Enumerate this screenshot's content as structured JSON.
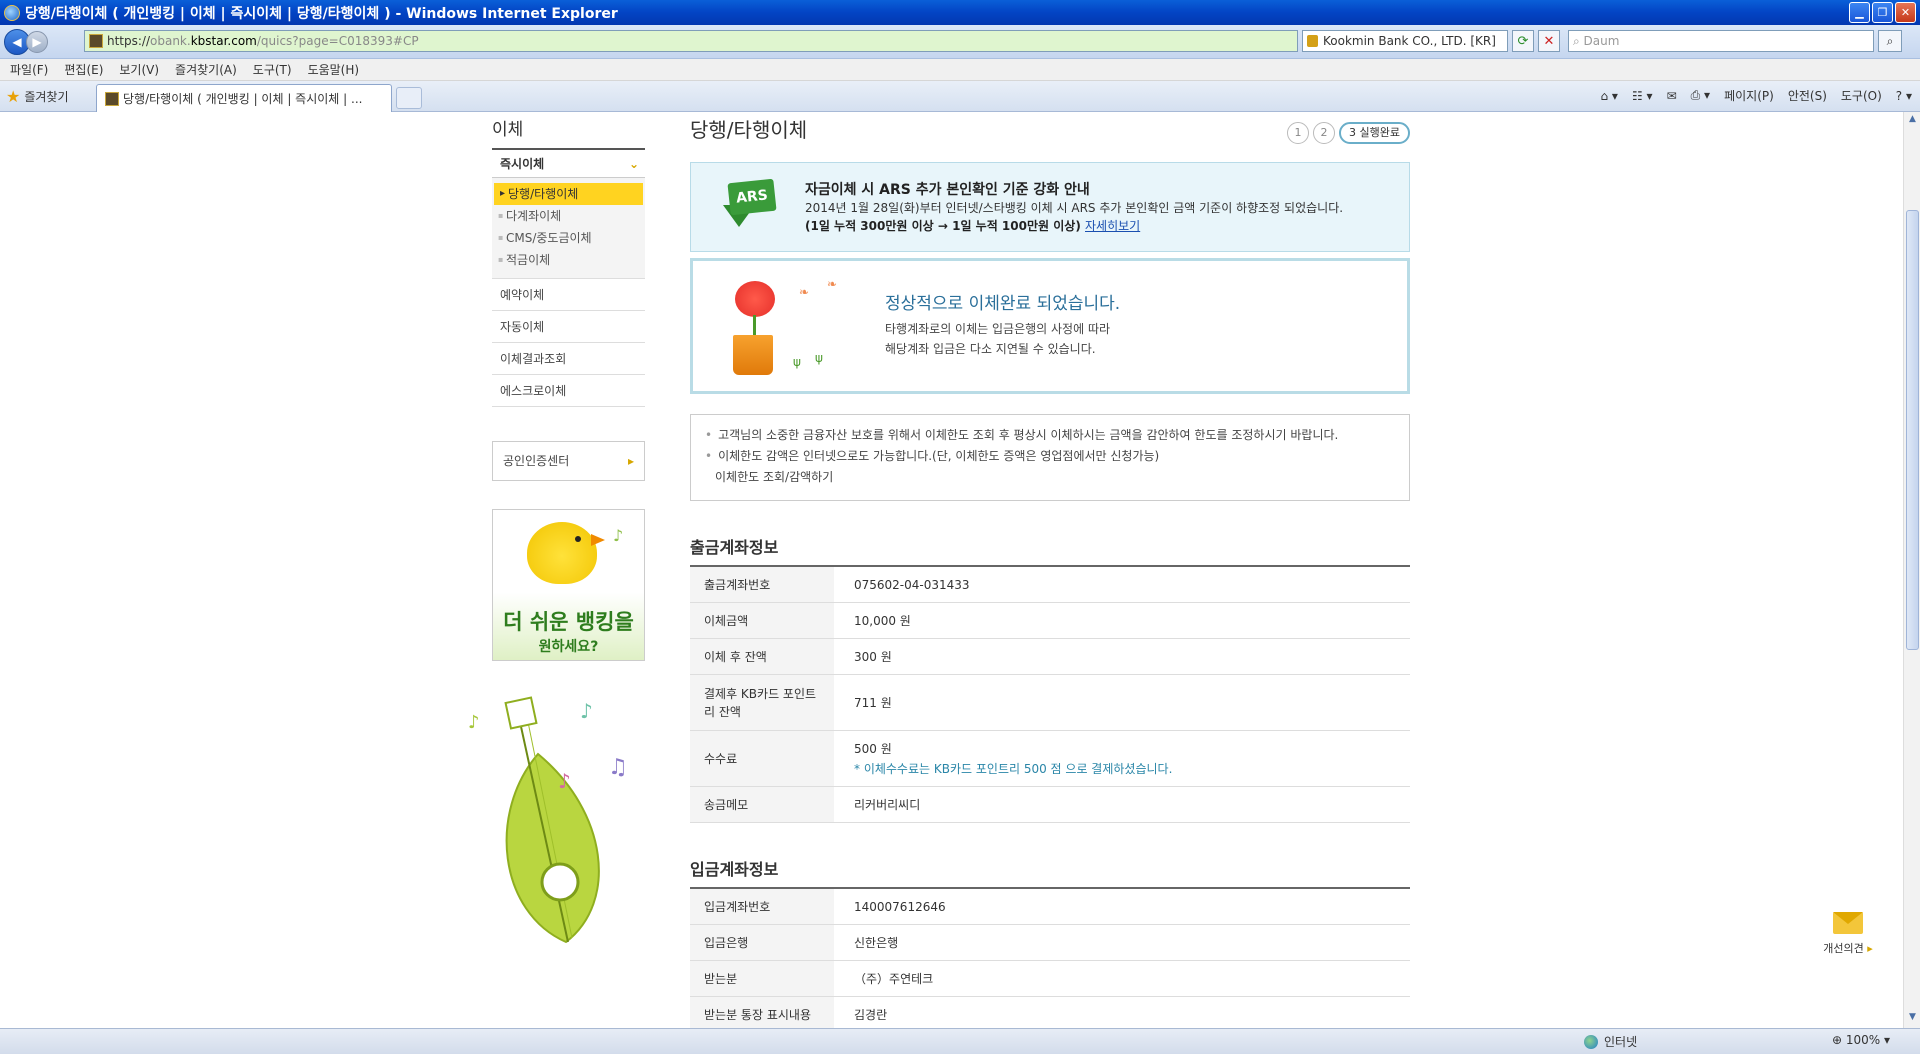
{
  "window": {
    "title": "당행/타행이체 ( 개인뱅킹 | 이체 | 즉시이체 | 당행/타행이체 ) - Windows Internet Explorer"
  },
  "addressbar": {
    "url_scheme": "https://",
    "url_sub": "obank.",
    "url_host": "kbstar.com",
    "url_path": "/quics?page=C018393#CP",
    "cert_label": "Kookmin Bank CO., LTD. [KR]",
    "search_placeholder": "Daum"
  },
  "menubar": {
    "items": [
      "파일(F)",
      "편집(E)",
      "보기(V)",
      "즐겨찾기(A)",
      "도구(T)",
      "도움말(H)"
    ]
  },
  "tabbar": {
    "favorites_label": "즐겨찾기",
    "active_tab": "당행/타행이체 ( 개인뱅킹 | 이체 | 즉시이체 | ...",
    "cmd_page": "페이지(P)",
    "cmd_safety": "안전(S)",
    "cmd_tools": "도구(O)"
  },
  "lnb": {
    "title": "이체",
    "section": "즉시이체",
    "sub_items": [
      "당행/타행이체",
      "다계좌이체",
      "CMS/중도금이체",
      "적금이체"
    ],
    "items": [
      "예약이체",
      "자동이체",
      "이체결과조회",
      "에스크로이체"
    ],
    "cert_center": "공인인증센터",
    "banner_line1": "더 쉬운 뱅킹을",
    "banner_line2": "원하세요?"
  },
  "main": {
    "title": "당행/타행이체",
    "steps": [
      "1",
      "2",
      "3 실행완료"
    ],
    "notice": {
      "badge": "ARS",
      "heading": "자금이체 시 ARS 추가 본인확인 기준 강화 안내",
      "body": "2014년 1월 28일(화)부터 인터넷/스타뱅킹 이체 시 ARS 추가 본인확인 금액 기준이 하향조정 되었습니다.",
      "criteria": "(1일 누적 300만원 이상 → 1일 누적 100만원 이상)",
      "more_link": "자세히보기"
    },
    "complete": {
      "heading": "정상적으로 이체완료 되었습니다.",
      "line1": "타행계좌로의 이체는 입금은행의 사정에 따라",
      "line2": "해당계좌 입금은 다소 지연될 수 있습니다."
    },
    "info": {
      "line1": "고객님의 소중한 금융자산 보호를 위해서 이체한도 조회 후 평상시 이체하시는 금액을 감안하여 한도를 조정하시기 바랍니다.",
      "line2": "이체한도 감액은 인터넷으로도 가능합니다.(단, 이체한도 증액은 영업점에서만 신청가능)",
      "line3": "이체한도 조회/감액하기"
    },
    "withdraw": {
      "title": "출금계좌정보",
      "rows": [
        {
          "label": "출금계좌번호",
          "value": "075602-04-031433"
        },
        {
          "label": "이체금액",
          "value": "10,000 원"
        },
        {
          "label": "이체 후 잔액",
          "value": "300 원"
        },
        {
          "label": "결제후 KB카드 포인트리 잔액",
          "value": "711 원"
        },
        {
          "label": "수수료",
          "value": "500 원",
          "note": "* 이체수수료는 KB카드 포인트리 500 점 으로 결제하셨습니다."
        },
        {
          "label": "송금메모",
          "value": "리커버리씨디"
        }
      ]
    },
    "deposit": {
      "title": "입금계좌정보",
      "rows": [
        {
          "label": "입금계좌번호",
          "value": "140007612646"
        },
        {
          "label": "입금은행",
          "value": "신한은행"
        },
        {
          "label": "받는분",
          "value": "（주）주연테크"
        },
        {
          "label": "받는분 통장 표시내용",
          "value": "김경란"
        }
      ]
    },
    "feedback_label": "개선의견"
  },
  "statusbar": {
    "zone": "인터넷",
    "zoom": "100%"
  },
  "colors": {
    "accent_yellow": "#ffd320",
    "titlebar_blue": "#0344c4",
    "notice_bg": "#e8f5fa",
    "complete_heading": "#2a6f9a"
  }
}
